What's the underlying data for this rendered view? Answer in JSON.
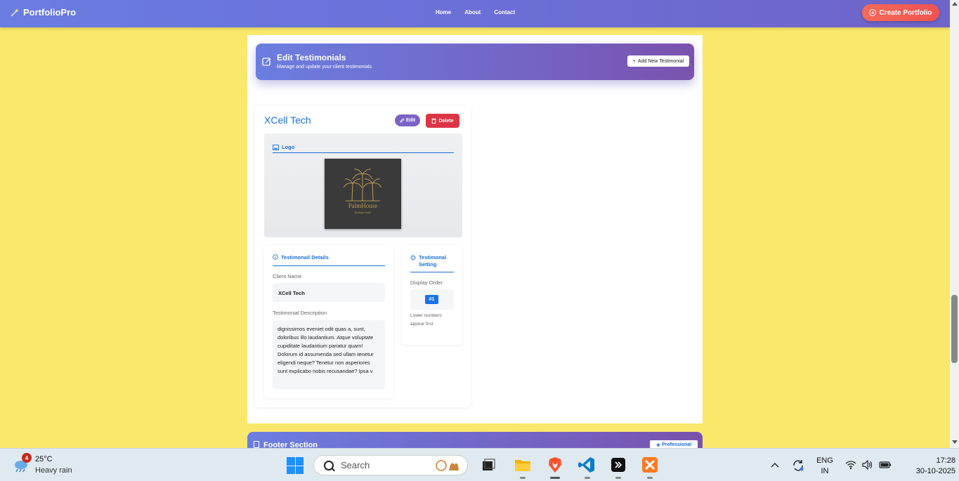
{
  "navbar": {
    "brand": "PortfolioPro",
    "links": [
      "Home",
      "About",
      "Contact"
    ],
    "create_label": "Create Portfolio"
  },
  "header": {
    "title": "Edit Testimonials",
    "subtitle": "Manage and update your client testimonials",
    "add_label": "Add New Testimonial"
  },
  "testimonial": {
    "name": "XCell Tech",
    "edit_label": "Edit",
    "delete_label": "Delete",
    "logo_heading": "Logo",
    "logo_text": "PalmHouse",
    "logo_tagline": "Boutique Hotel",
    "details_heading": "Testimonail Details",
    "client_name_label": "Client Name",
    "client_name": "XCell Tech",
    "description_label": "Testimonial Description",
    "description": " dignissimos eveniet odit quas a, sunt, doloribus illo laudantium. Atque voluptate cupiditate laudantium pariatur quam! Dolorum id assumenda sed ullam tenetur eligendi neque? Tenetur non asperiores sunt explicabo nobis recusandae? Ipsa v",
    "setting_heading": "Testimonal Setting",
    "display_order_label": "Display Order",
    "display_order": "#1",
    "order_hint": "Lower numbers appear first"
  },
  "footer_section": {
    "title": "Footer Section",
    "badge": "Professional"
  },
  "taskbar": {
    "weather_badge": "4",
    "temperature": "25°C",
    "condition": "Heavy rain",
    "search_placeholder": "Search",
    "lang": "ENG",
    "region": "IN",
    "time": "17:28",
    "date": "30-10-2025"
  },
  "colors": {
    "page_bg": "#f9e86b",
    "accent_blue": "#1a6fd4",
    "delete_red": "#dc3545",
    "create_red": "#ef5350"
  }
}
